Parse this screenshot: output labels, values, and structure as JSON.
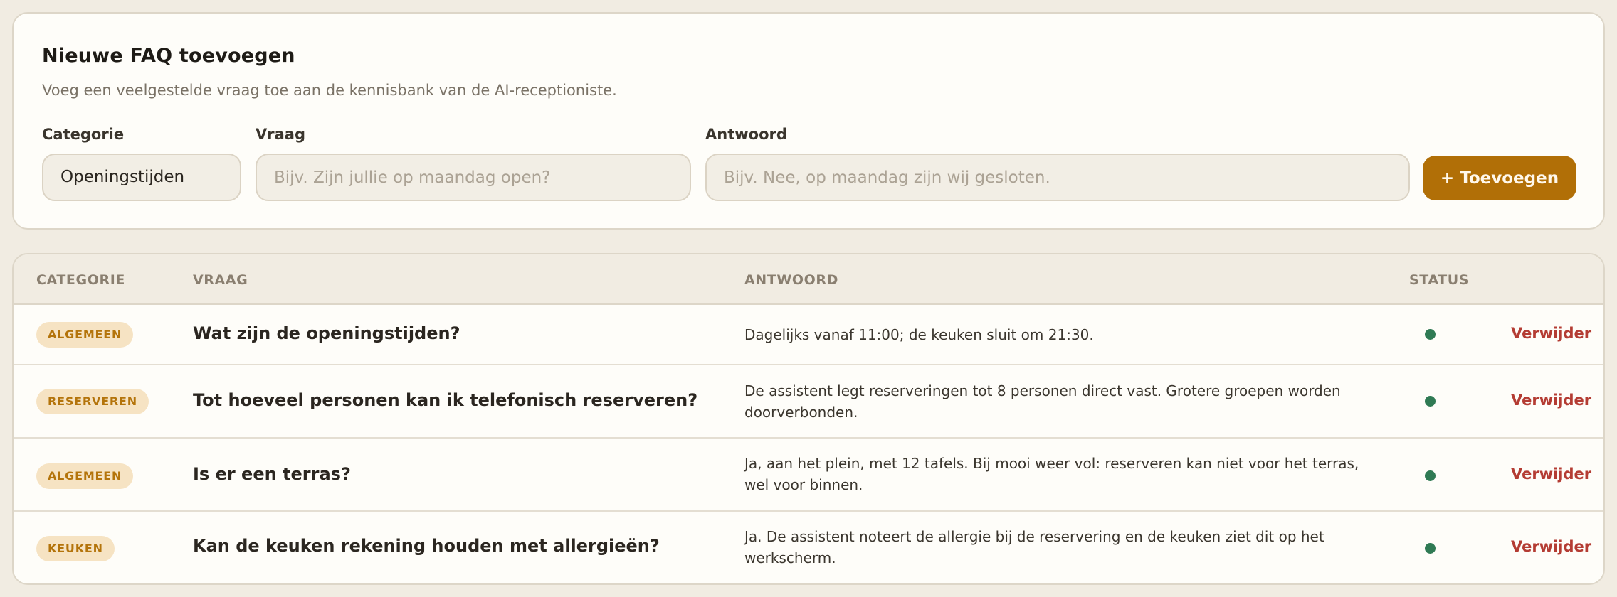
{
  "form": {
    "title": "Nieuwe FAQ toevoegen",
    "description": "Voeg een veelgestelde vraag toe aan de kennisbank van de AI-receptioniste.",
    "category_label": "Categorie",
    "category_value": "Openingstijden",
    "question_label": "Vraag",
    "question_placeholder": "Bijv. Zijn jullie op maandag open?",
    "answer_label": "Antwoord",
    "answer_placeholder": "Bijv. Nee, op maandag zijn wij gesloten.",
    "add_button": "+ Toevoegen"
  },
  "table": {
    "headers": {
      "category": "CATEGORIE",
      "question": "VRAAG",
      "answer": "ANTWOORD",
      "status": "STATUS"
    },
    "rows": [
      {
        "category": "ALGEMEEN",
        "question": "Wat zijn de openingstijden?",
        "answer": "Dagelijks vanaf 11:00; de keuken sluit om 21:30.",
        "status": "active",
        "delete": "Verwijder"
      },
      {
        "category": "RESERVEREN",
        "question": "Tot hoeveel personen kan ik telefonisch reserveren?",
        "answer": "De assistent legt reserveringen tot 8 personen direct vast. Grotere groepen worden doorverbonden.",
        "status": "active",
        "delete": "Verwijder"
      },
      {
        "category": "ALGEMEEN",
        "question": "Is er een terras?",
        "answer": "Ja, aan het plein, met 12 tafels. Bij mooi weer vol: reserveren kan niet voor het terras, wel voor binnen.",
        "status": "active",
        "delete": "Verwijder"
      },
      {
        "category": "KEUKEN",
        "question": "Kan de keuken rekening houden met allergieën?",
        "answer": "Ja. De assistent noteert de allergie bij de reservering en de keuken ziet dit op het werkscherm.",
        "status": "active",
        "delete": "Verwijder"
      }
    ]
  },
  "colors": {
    "accent": "#b16f07",
    "status_active": "#2f7a54",
    "delete": "#b43c33",
    "badge_bg": "#f6e3c3"
  }
}
